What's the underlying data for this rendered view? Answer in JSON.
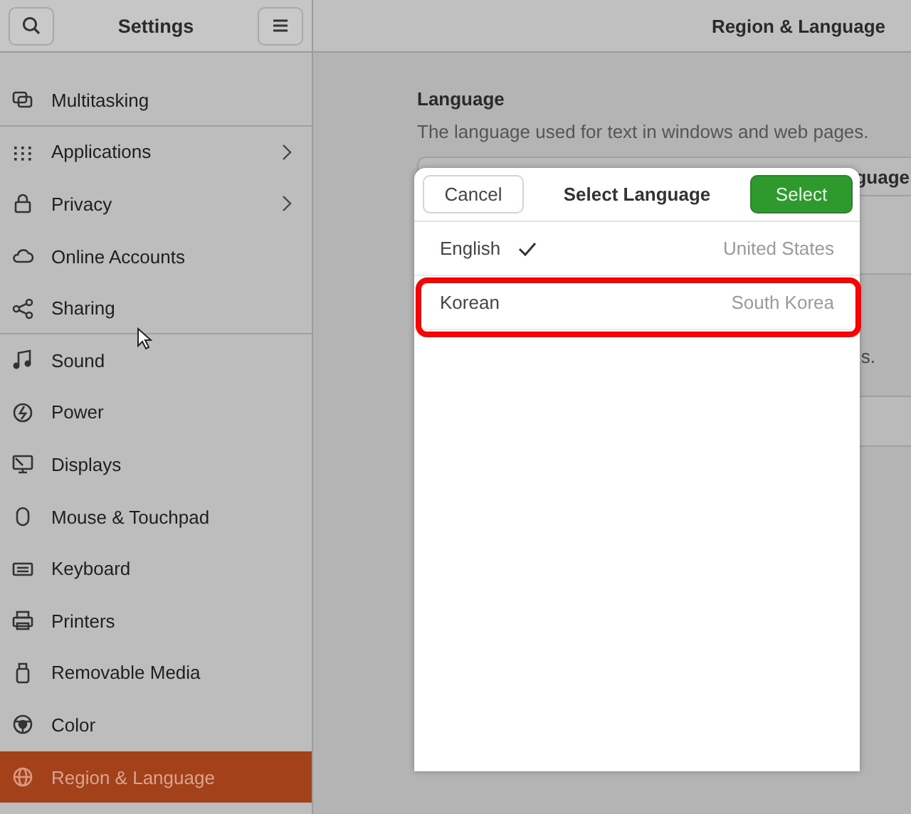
{
  "sidebar": {
    "title": "Settings",
    "items": [
      {
        "label": "Multitasking",
        "selected": false,
        "submenu": false,
        "divider_after": true
      },
      {
        "label": "Applications",
        "selected": false,
        "submenu": true,
        "divider_after": false
      },
      {
        "label": "Privacy",
        "selected": false,
        "submenu": true,
        "divider_after": false
      },
      {
        "label": "Online Accounts",
        "selected": false,
        "submenu": false,
        "divider_after": false
      },
      {
        "label": "Sharing",
        "selected": false,
        "submenu": false,
        "divider_after": true
      },
      {
        "label": "Sound",
        "selected": false,
        "submenu": false,
        "divider_after": false
      },
      {
        "label": "Power",
        "selected": false,
        "submenu": false,
        "divider_after": false
      },
      {
        "label": "Displays",
        "selected": false,
        "submenu": false,
        "divider_after": false
      },
      {
        "label": "Mouse & Touchpad",
        "selected": false,
        "submenu": false,
        "divider_after": false
      },
      {
        "label": "Keyboard",
        "selected": false,
        "submenu": false,
        "divider_after": false
      },
      {
        "label": "Printers",
        "selected": false,
        "submenu": false,
        "divider_after": false
      },
      {
        "label": "Removable Media",
        "selected": false,
        "submenu": false,
        "divider_after": false
      },
      {
        "label": "Color",
        "selected": false,
        "submenu": false,
        "divider_after": false
      },
      {
        "label": "Region & Language",
        "selected": true,
        "submenu": false,
        "divider_after": false
      }
    ]
  },
  "main": {
    "title": "Region & Language",
    "section": "Language",
    "description": "The language used for text in windows and web pages.",
    "button_fragment": "guage",
    "text_fragment": "s."
  },
  "dialog": {
    "title": "Select Language",
    "cancel": "Cancel",
    "confirm": "Select",
    "rows": [
      {
        "language": "English",
        "region": "United States",
        "checked": true,
        "highlighted": false
      },
      {
        "language": "Korean",
        "region": "South Korea",
        "checked": false,
        "highlighted": true
      }
    ]
  }
}
